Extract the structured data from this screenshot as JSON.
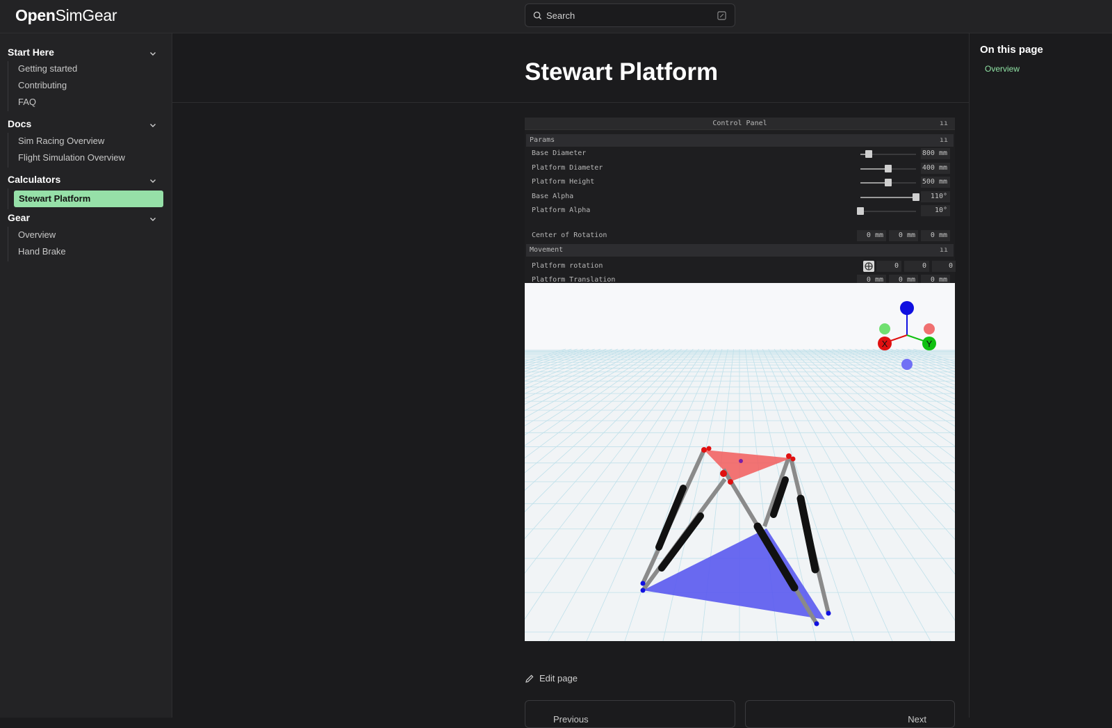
{
  "brand": {
    "bold": "Open",
    "rest": "SimGear"
  },
  "search": {
    "placeholder": "Search"
  },
  "sidebar": {
    "sections": [
      {
        "title": "Start Here",
        "items": [
          "Getting started",
          "Contributing",
          "FAQ"
        ]
      },
      {
        "title": "Docs",
        "items": [
          "Sim Racing Overview",
          "Flight Simulation Overview"
        ]
      },
      {
        "title": "Calculators",
        "items": [
          "Stewart Platform"
        ]
      },
      {
        "title": "Gear",
        "items": [
          "Overview",
          "Hand Brake"
        ]
      }
    ],
    "active_item": "Stewart Platform"
  },
  "page": {
    "title": "Stewart Platform",
    "edit_label": "Edit page",
    "prev_label": "Previous",
    "next_label": "Next"
  },
  "toc": {
    "heading": "On this page",
    "items": [
      "Overview"
    ]
  },
  "control_panel": {
    "title": "Control Panel",
    "params_label": "Params",
    "movement_label": "Movement",
    "params": [
      {
        "label": "Base Diameter",
        "value": "800 mm",
        "slider": 0.15
      },
      {
        "label": "Platform Diameter",
        "value": "400 mm",
        "slider": 0.5
      },
      {
        "label": "Platform Height",
        "value": "500 mm",
        "slider": 0.5
      },
      {
        "label": "Base Alpha",
        "value": "110°",
        "slider": 1.0
      },
      {
        "label": "Platform Alpha",
        "value": "10°",
        "slider": 0.0
      }
    ],
    "center_of_rotation": {
      "label": "Center of Rotation",
      "values": [
        "0 mm",
        "0 mm",
        "0 mm"
      ]
    },
    "platform_rotation": {
      "label": "Platform rotation",
      "values": [
        "0",
        "0",
        "0"
      ]
    },
    "platform_translation": {
      "label": "Platform Translation",
      "values": [
        "0 mm",
        "0 mm",
        "0 mm"
      ]
    }
  },
  "gizmo": {
    "x_label": "X",
    "y_label": "Y"
  },
  "colors": {
    "accent": "#96e0a8",
    "link": "#8fe2a4",
    "platform": "#f25c5c",
    "base": "#5a5af0"
  }
}
